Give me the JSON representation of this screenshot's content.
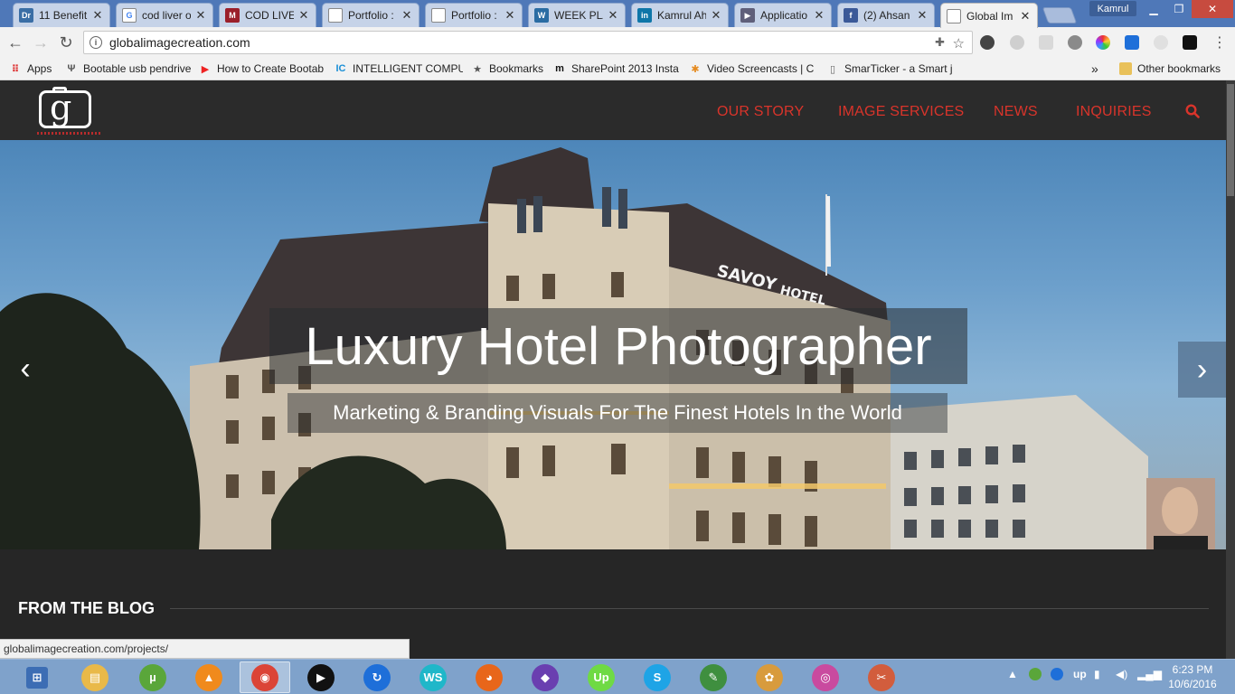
{
  "window": {
    "user_name": "Kamrul"
  },
  "tabs": [
    {
      "title": "11 Benefit",
      "favicon": "dr-axe-icon",
      "color": "#3a6ea5",
      "glyph": "Dr"
    },
    {
      "title": "cod liver o",
      "favicon": "google-icon",
      "color": "#ffffff",
      "glyph": "G"
    },
    {
      "title": "COD LIVE",
      "favicon": "m-icon",
      "color": "#9b1f2a",
      "glyph": "M"
    },
    {
      "title": "Portfolio :",
      "favicon": "page-icon",
      "color": "#ffffff",
      "glyph": ""
    },
    {
      "title": "Portfolio :",
      "favicon": "page-icon",
      "color": "#ffffff",
      "glyph": ""
    },
    {
      "title": "WEEK PLA",
      "favicon": "wordpress-icon",
      "color": "#2a6ca3",
      "glyph": "W"
    },
    {
      "title": "Kamrul Ah",
      "favicon": "linkedin-icon",
      "color": "#0e76a8",
      "glyph": "in"
    },
    {
      "title": "Applicatio",
      "favicon": "visual-studio-icon",
      "color": "#5f5f7a",
      "glyph": "▶"
    },
    {
      "title": "(2) Ahsan",
      "favicon": "facebook-icon",
      "color": "#3b5998",
      "glyph": "f"
    },
    {
      "title": "Global Im",
      "favicon": "page-icon",
      "color": "#ffffff",
      "glyph": "",
      "active": true
    }
  ],
  "omnibox": {
    "url": "globalimagecreation.com"
  },
  "bookmarks": [
    {
      "label": "Apps",
      "icon": "apps-grid-icon",
      "glyph": "⠿",
      "color": "#d33"
    },
    {
      "label": "Bootable usb pendrive",
      "icon": "usb-icon",
      "glyph": "Ψ",
      "color": "#555"
    },
    {
      "label": "How to Create Bootab",
      "icon": "youtube-icon",
      "glyph": "▶",
      "color": "#e22"
    },
    {
      "label": "INTELLIGENT COMPUT",
      "icon": "ic-icon",
      "glyph": "IC",
      "color": "#1a8fd6"
    },
    {
      "label": "Bookmarks",
      "icon": "star-icon",
      "glyph": "★",
      "color": "#555"
    },
    {
      "label": "SharePoint 2013 Insta",
      "icon": "m-black-icon",
      "glyph": "m",
      "color": "#111"
    },
    {
      "label": "Video Screencasts | C",
      "icon": "asterisk-icon",
      "glyph": "✱",
      "color": "#e58a1f"
    },
    {
      "label": "SmarTicker - a Smart j",
      "icon": "page-icon",
      "glyph": "▯",
      "color": "#666"
    }
  ],
  "bookmarks_overflow": "»",
  "other_bookmarks": "Other bookmarks",
  "site": {
    "nav": [
      "OUR STORY",
      "IMAGE SERVICES",
      "NEWS",
      "INQUIRIES"
    ],
    "hero_title": "Luxury Hotel Photographer",
    "hero_subtitle": "Marketing & Branding Visuals For The Finest Hotels In the World",
    "building_sign": "SAVOY",
    "building_sign_2": "HOTEL",
    "blog_heading": "FROM THE BLOG",
    "accent": "#d9342b"
  },
  "status_bar": {
    "url": "globalimagecreation.com/projects/"
  },
  "taskbar": {
    "apps": [
      {
        "name": "start-icon",
        "glyph": "⊞",
        "color": "#3c6db4"
      },
      {
        "name": "file-explorer-icon",
        "glyph": "▤",
        "color": "#e9b949"
      },
      {
        "name": "utorrent-icon",
        "glyph": "µ",
        "color": "#5aa63a"
      },
      {
        "name": "vlc-icon",
        "glyph": "▲",
        "color": "#f08a1c"
      },
      {
        "name": "chrome-icon",
        "glyph": "◉",
        "color": "#db4437",
        "active": true
      },
      {
        "name": "media-player-icon",
        "glyph": "▶",
        "color": "#111111"
      },
      {
        "name": "teamviewer-icon",
        "glyph": "↻",
        "color": "#1e6fd9"
      },
      {
        "name": "webstorm-icon",
        "glyph": "WS",
        "color": "#1fb7c9"
      },
      {
        "name": "firefox-icon",
        "glyph": "◕",
        "color": "#e8661a"
      },
      {
        "name": "visual-studio-icon",
        "glyph": "◆",
        "color": "#6a3fb0"
      },
      {
        "name": "upwork-icon",
        "glyph": "Up",
        "color": "#6fda44"
      },
      {
        "name": "skype-icon",
        "glyph": "S",
        "color": "#1ea4e6"
      },
      {
        "name": "notepad-icon",
        "glyph": "✎",
        "color": "#3f8f3f"
      },
      {
        "name": "paint-icon",
        "glyph": "✿",
        "color": "#d89b3d"
      },
      {
        "name": "picasa-icon",
        "glyph": "◎",
        "color": "#c94a9f"
      },
      {
        "name": "snipping-icon",
        "glyph": "✂",
        "color": "#d25d3d"
      }
    ],
    "clock_time": "6:23 PM",
    "clock_date": "10/6/2016"
  }
}
